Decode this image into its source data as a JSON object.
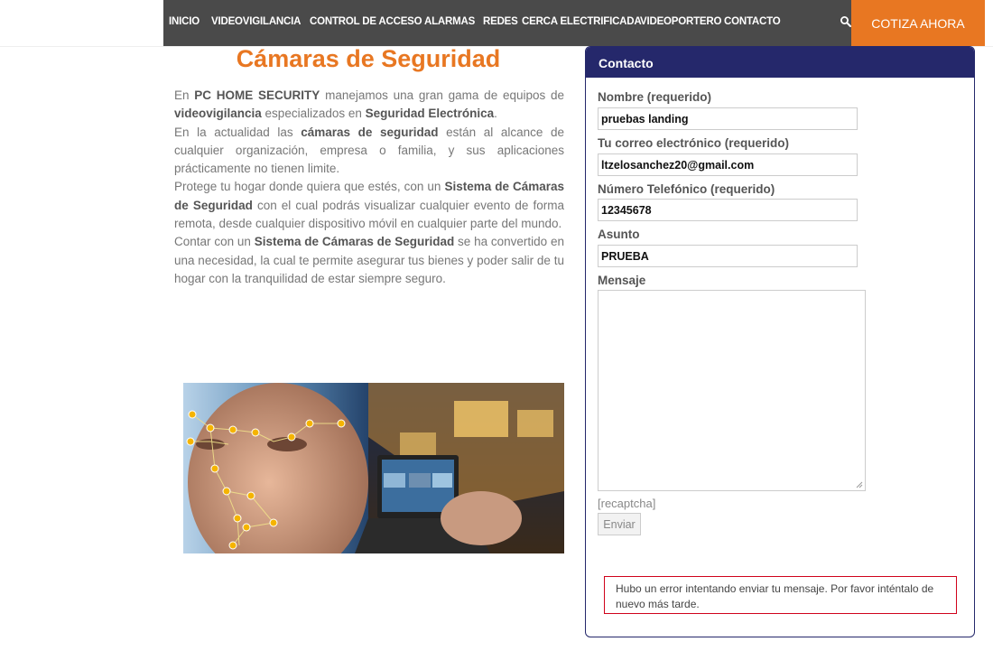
{
  "nav": {
    "items": [
      "INICIO",
      "VIDEOVIGILANCIA",
      "CONTROL DE ACCESO",
      "ALARMAS",
      "REDES",
      "CERCA ELECTRIFICADA",
      "VIDEOPORTERO",
      "CONTACTO"
    ],
    "search_icon": "search-icon",
    "cta_label": "COTIZA AHORA"
  },
  "colors": {
    "nav_bg": "#4a4a4a",
    "accent": "#e87722",
    "panel": "#25286b",
    "error_border": "#d0021b"
  },
  "main": {
    "title": "Cámaras de Seguridad",
    "p1_a": "En ",
    "p1_b": "PC HOME SECURITY",
    "p1_c": " manejamos una gran gama de equipos de ",
    "p1_d": "videovigilancia",
    "p1_e": " especializados en ",
    "p1_f": "Seguridad Electrónica",
    "p1_g": ".",
    "p2_a": "En la actualidad las ",
    "p2_b": "cámaras de seguridad",
    "p2_c": " están al alcance de cualquier organización, empresa o familia, y sus aplicaciones prácticamente no tienen limite.",
    "p3_a": "Protege tu hogar donde quiera que estés, con un ",
    "p3_b": "Sistema de Cámaras de Seguridad",
    "p3_c": " con el cual podrás visualizar cualquier evento de forma remota, desde cualquier dispositivo móvil en cualquier parte del mundo.",
    "p4_a": "Contar con un ",
    "p4_b": "Sistema de Cámaras de Seguridad",
    "p4_c": " se ha convertido en una necesidad, la cual te permite asegurar tus bienes y poder salir de tu hogar con la tranquilidad de estar siempre seguro."
  },
  "contact": {
    "title": "Contacto",
    "name_label": "Nombre (requerido)",
    "name_value": "pruebas landing",
    "email_label": "Tu correo electrónico (requerido)",
    "email_value": "ltzelosanchez20@gmail.com",
    "phone_label": "Número Telefónico (requerido)",
    "phone_value": "12345678",
    "subject_label": "Asunto",
    "subject_value": "PRUEBA",
    "message_label": "Mensaje",
    "recaptcha": "[recaptcha]",
    "submit_label": "Enviar",
    "error_message": "Hubo un error intentando enviar tu mensaje. Por favor inténtalo de nuevo más tarde."
  }
}
